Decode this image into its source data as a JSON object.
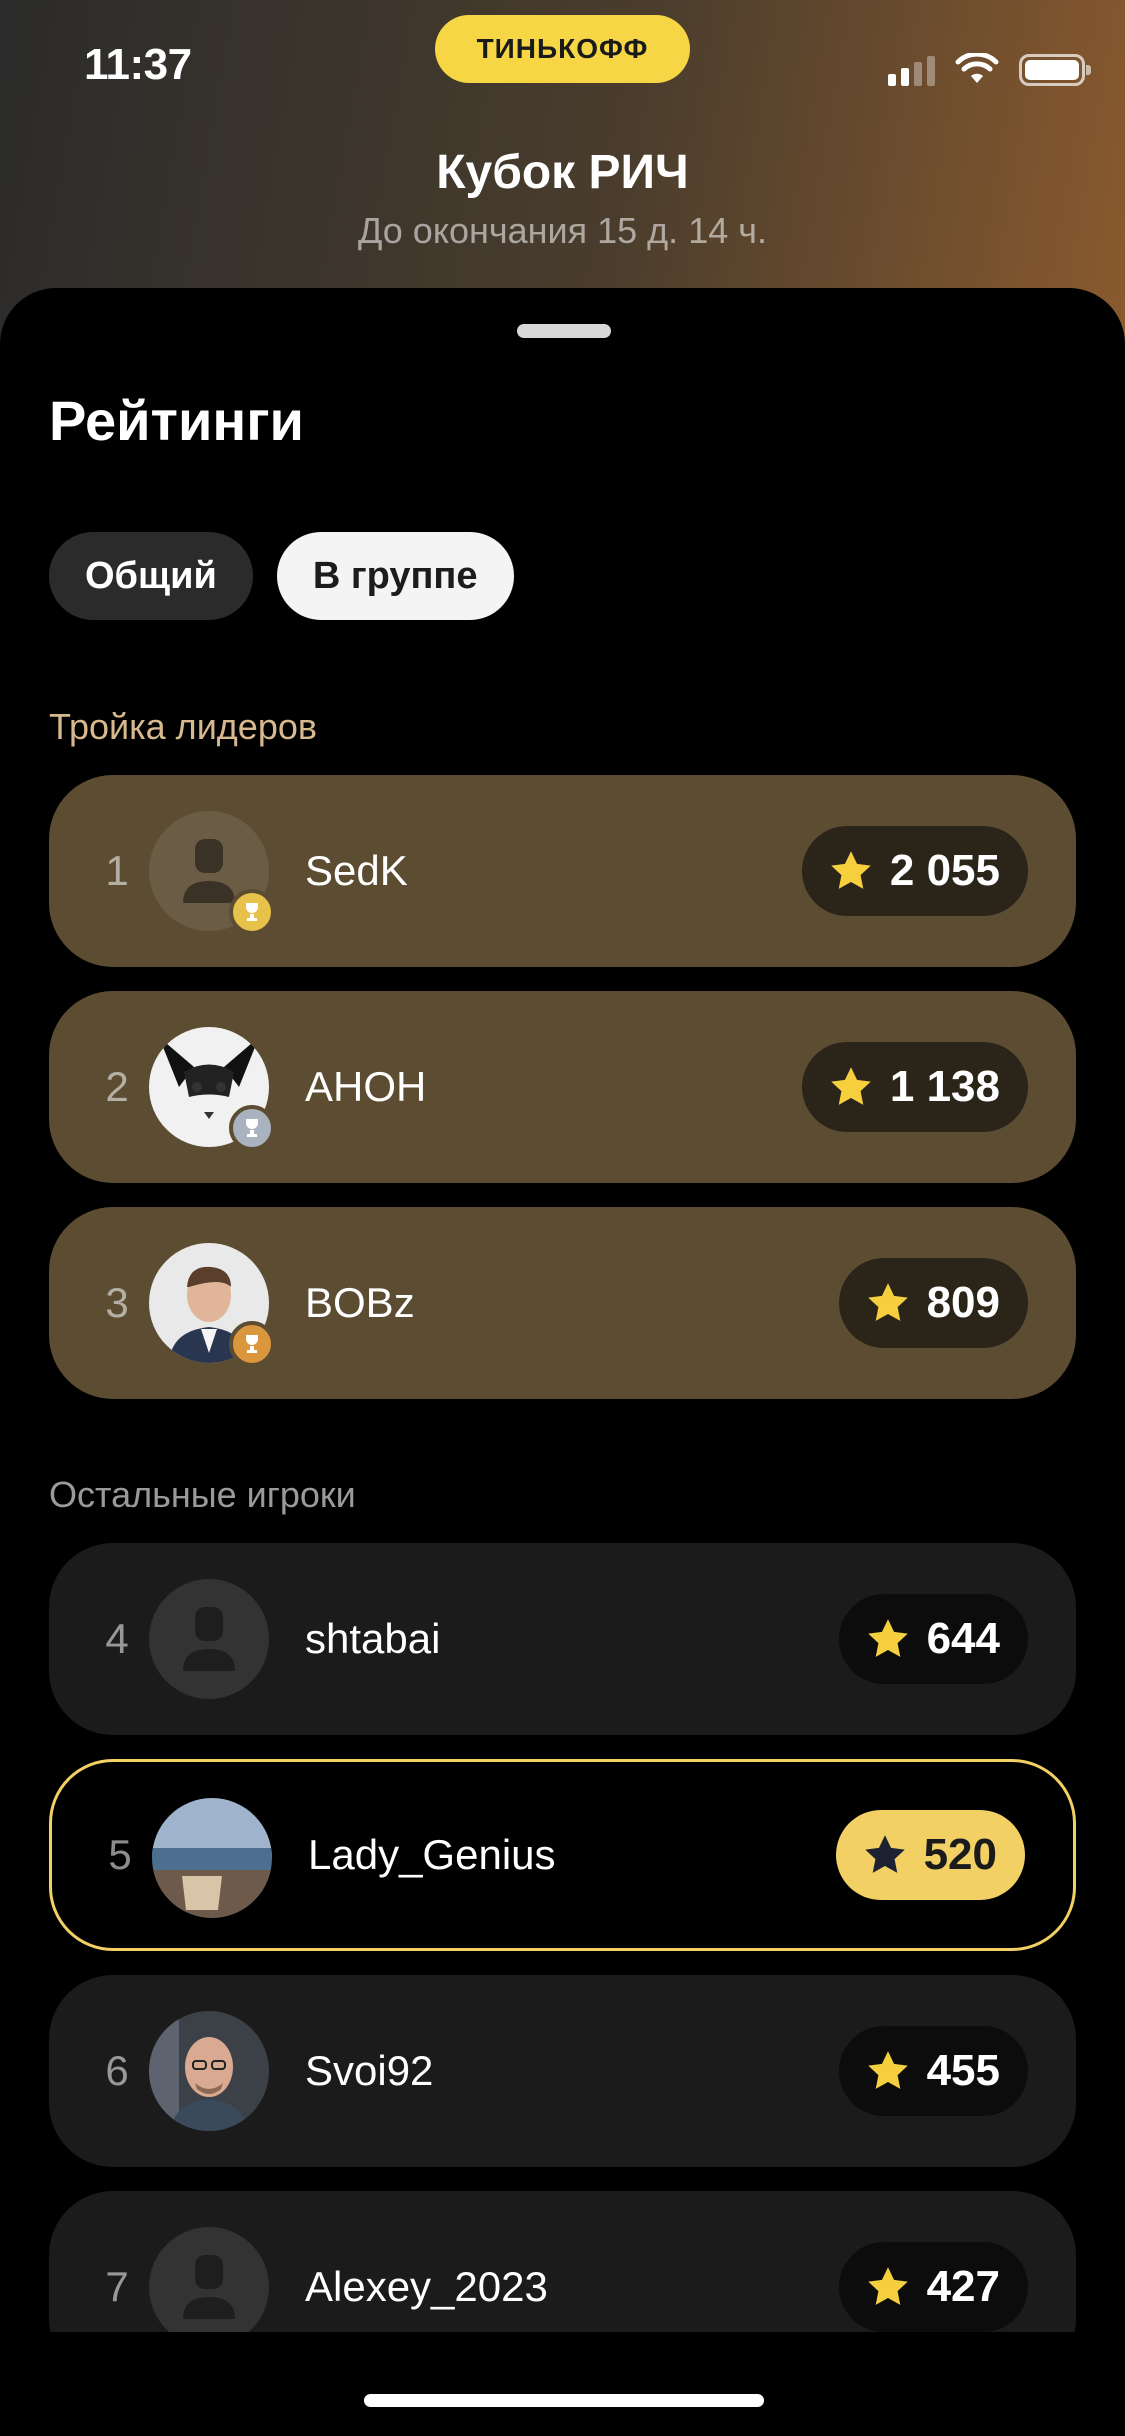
{
  "status_bar": {
    "time": "11:37",
    "brand": "ТИНЬКОФФ"
  },
  "header": {
    "title": "Кубок РИЧ",
    "subtitle": "До окончания 15 д. 14 ч."
  },
  "sheet": {
    "title": "Рейтинги"
  },
  "tabs": [
    {
      "label": "Общий",
      "active": false
    },
    {
      "label": "В группе",
      "active": true
    }
  ],
  "sections": {
    "leaders": "Тройка лидеров",
    "others": "Остальные игроки"
  },
  "leaders": [
    {
      "rank": "1",
      "name": "SedK",
      "score": "2 055",
      "trophy": "gold",
      "avatar": "placeholder"
    },
    {
      "rank": "2",
      "name": "АНОН",
      "score": "1 138",
      "trophy": "silver",
      "avatar": "cat-photo"
    },
    {
      "rank": "3",
      "name": "BOBz",
      "score": "809",
      "trophy": "bronze",
      "avatar": "man-photo"
    }
  ],
  "others": [
    {
      "rank": "4",
      "name": "shtabai",
      "score": "644",
      "avatar": "placeholder"
    },
    {
      "rank": "5",
      "name": "Lady_Genius",
      "score": "520",
      "avatar": "sea-photo",
      "current_user": true
    },
    {
      "rank": "6",
      "name": "Svoi92",
      "score": "455",
      "avatar": "bald-man-photo"
    },
    {
      "rank": "7",
      "name": "Alexey_2023",
      "score": "427",
      "avatar": "placeholder"
    }
  ],
  "colors": {
    "accent": "#f2d064",
    "leader_row": "#5b4c32",
    "other_row": "#1b1b1b"
  }
}
